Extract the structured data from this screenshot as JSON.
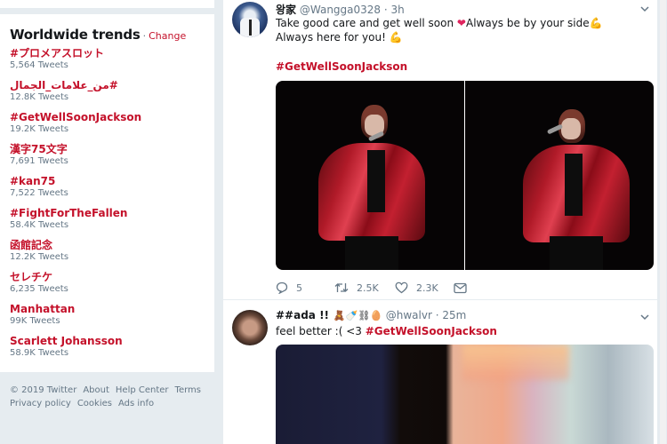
{
  "trends": {
    "title": "Worldwide trends",
    "separator": "·",
    "change_label": "Change",
    "items": [
      {
        "name": "#プロメアスロット",
        "count": "5,564 Tweets"
      },
      {
        "name": "#من_علامات_الجمال",
        "count": "12.8K Tweets"
      },
      {
        "name": "#GetWellSoonJackson",
        "count": "19.2K Tweets"
      },
      {
        "name": "漢字75文字",
        "count": "7,691 Tweets"
      },
      {
        "name": "#kan75",
        "count": "7,522 Tweets"
      },
      {
        "name": "#FightForTheFallen",
        "count": "58.4K Tweets"
      },
      {
        "name": "函館記念",
        "count": "12.2K Tweets"
      },
      {
        "name": "セレチケ",
        "count": "6,235 Tweets"
      },
      {
        "name": "Manhattan",
        "count": "99K Tweets"
      },
      {
        "name": "Scarlett Johansson",
        "count": "58.9K Tweets"
      }
    ]
  },
  "footer": {
    "links": [
      "© 2019 Twitter",
      "About",
      "Help Center",
      "Terms",
      "Privacy policy",
      "Cookies",
      "Ads info"
    ]
  },
  "tweets": [
    {
      "name": "왕家",
      "handle": "@Wangga0328",
      "time": "· 3h",
      "text_part1": "Take good care and get well soon ",
      "heart": "❤",
      "text_part2": "Always be by your side",
      "flex1": "💪",
      "text_part3": " Always here for you! ",
      "flex2": "💪",
      "hashtag": "#GetWellSoonJackson",
      "actions": {
        "replies": "5",
        "retweets": "2.5K",
        "likes": "2.3K"
      }
    },
    {
      "name": "##ada !!",
      "name_emojis": "🧸🍼⛓🥚",
      "handle": "@hwalvr",
      "time": "· 25m",
      "text": "feel better :( <3 ",
      "hashtag": "#GetWellSoonJackson"
    }
  ],
  "colors": {
    "accent": "#c4112a",
    "secondary_text": "#657786",
    "background": "#e6ecf0"
  }
}
